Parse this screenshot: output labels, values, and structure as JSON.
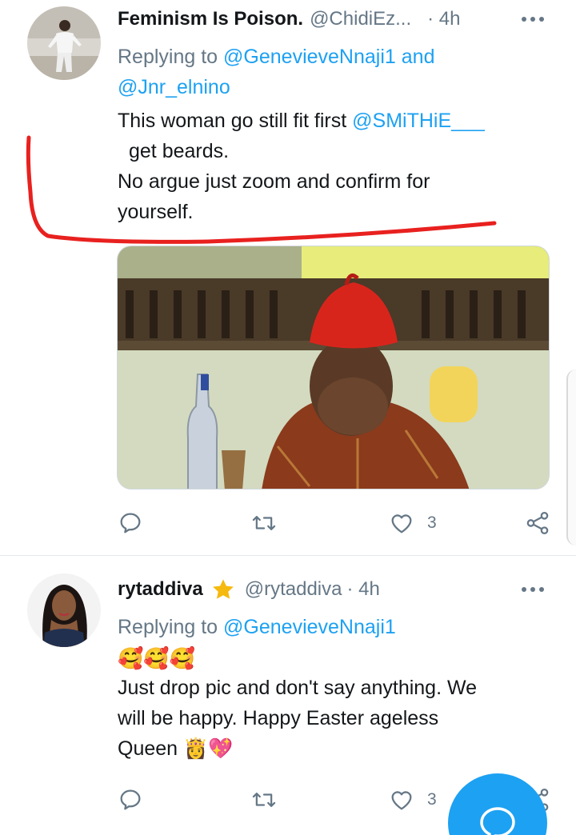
{
  "tweets": [
    {
      "display_name": "Feminism Is Poison.",
      "handle": "@ChidiEz...",
      "time": "· 4h",
      "reply_prefix": "Replying to",
      "reply_mention_1": "@GenevieveNnaji1",
      "reply_and": "and",
      "reply_mention_2": "@Jnr_elnino",
      "line1_text": "This woman go still fit first",
      "line1_mention": "@SMiTHiE___",
      "line2": "get beards.",
      "line3": "No argue just zoom and confirm for",
      "line4": "yourself.",
      "likes": "3"
    },
    {
      "display_name": "rytaddiva",
      "handle": "@rytaddiva",
      "time": "· 4h",
      "reply_prefix": "Replying to",
      "reply_mention_1": "@GenevieveNnaji1",
      "emoji_line": "🥰🥰🥰",
      "line1": "Just drop pic and don't say anything. We",
      "line2": "will be  happy.  Happy Easter ageless",
      "line3": "Queen",
      "line3_emoji": "👸💖",
      "likes": "3"
    }
  ],
  "icons": {
    "reply": "reply-icon",
    "retweet": "retweet-icon",
    "like": "heart-icon",
    "share": "share-icon",
    "more": "more-dots-icon",
    "verified_star": "star-icon",
    "compose": "compose-icon"
  },
  "colors": {
    "accent": "#1da1f2",
    "muted": "#657786",
    "text": "#14171a",
    "annotation": "#e8211f",
    "star": "#f5b90f"
  }
}
